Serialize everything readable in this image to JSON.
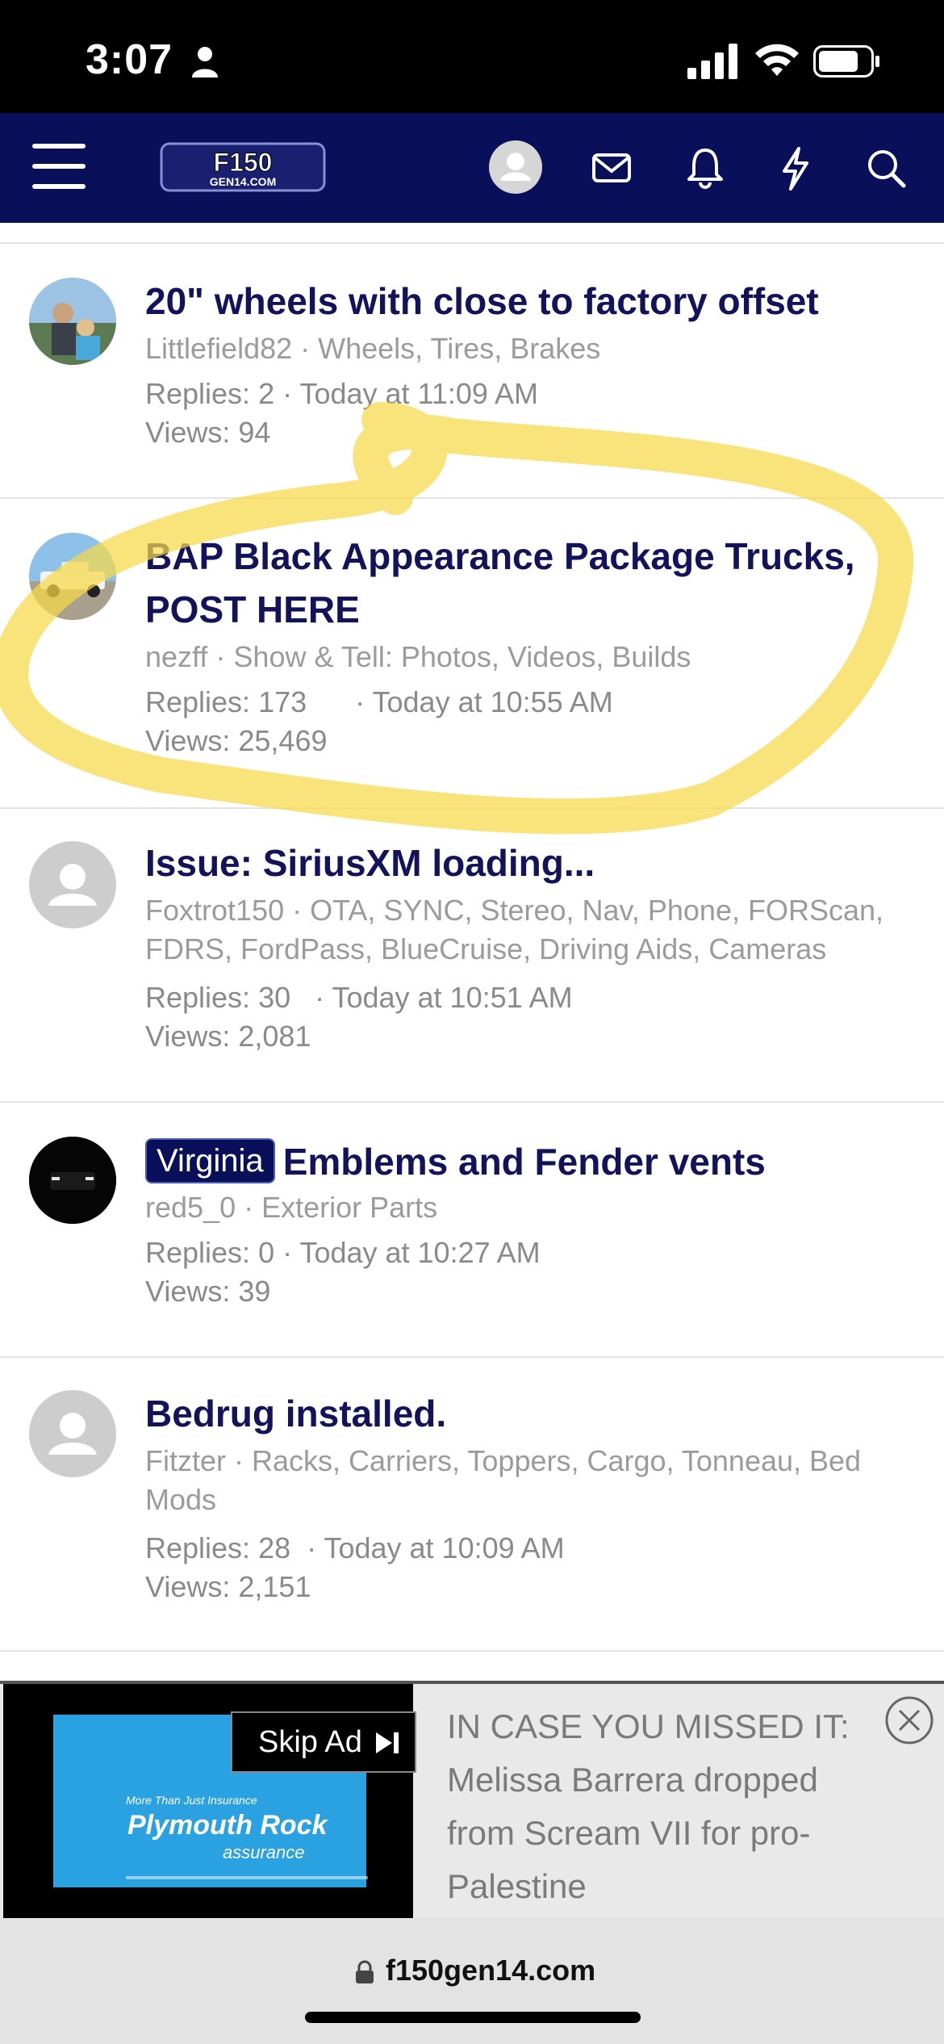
{
  "status_bar": {
    "time": "3:07"
  },
  "header": {
    "logo_text_main": "F150",
    "logo_text_sub": "GEN14.COM",
    "icons": [
      "menu-icon",
      "account-avatar",
      "mail-icon",
      "bell-icon",
      "bolt-icon",
      "search-icon"
    ]
  },
  "threads": [
    {
      "title": "20\" wheels with close to factory offset",
      "author": "Littlefield82",
      "forum": "Wheels, Tires, Brakes",
      "replies": "Replies: 2",
      "date": "Today at 11:09 AM",
      "views": "Views: 94"
    },
    {
      "title": "BAP Black Appearance Package Trucks, POST HERE",
      "author": "nezff",
      "forum": "Show & Tell: Photos, Videos, Builds",
      "replies": "Replies: 173",
      "date": "Today at 10:55 AM",
      "views": "Views: 25,469"
    },
    {
      "title": "Issue: SiriusXM loading...",
      "author": "Foxtrot150",
      "forum": "OTA, SYNC, Stereo, Nav, Phone, FORScan, FDRS, FordPass, BlueCruise, Driving Aids, Cameras",
      "replies": "Replies: 30",
      "date": "Today at 10:51 AM",
      "views": "Views: 2,081"
    },
    {
      "prefix": "Virginia",
      "title": "Emblems and Fender vents",
      "author": "red5_0",
      "forum": "Exterior Parts",
      "replies": "Replies: 0",
      "date": "Today at 10:27 AM",
      "views": "Views: 39"
    },
    {
      "title": "Bedrug installed.",
      "author": "Fitzter",
      "forum": "Racks, Carriers, Toppers, Cargo, Tonneau, Bed Mods",
      "replies": "Replies: 28",
      "date": "Today at 10:09 AM",
      "views": "Views: 2,151"
    }
  ],
  "ad": {
    "creative_tagline": "More Than Just Insurance",
    "creative_brand": "Plymouth Rock",
    "creative_brand_sub": "assurance",
    "skip_label": "Skip Ad",
    "headline": "IN CASE YOU MISSED IT: Melissa Barrera dropped from Scream VII for pro-Palestine"
  },
  "browser": {
    "url": "f150gen14.com"
  },
  "colors": {
    "navy": "#0a0f5a",
    "title": "#12135a",
    "highlight": "#f7d948"
  }
}
